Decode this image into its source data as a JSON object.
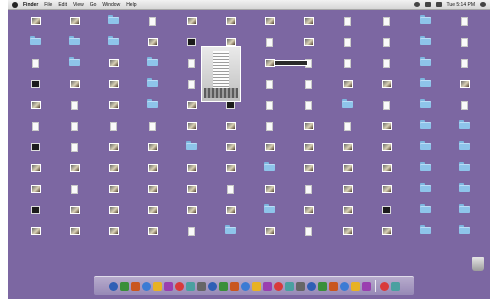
{
  "menubar": {
    "app_name": "Finder",
    "menus": [
      "File",
      "Edit",
      "View",
      "Go",
      "Window",
      "Help"
    ],
    "clock": "Tue 5:14 PM"
  },
  "desktop": {
    "background_color": "#7c67a2",
    "icons": [
      {
        "type": "image",
        "label": ""
      },
      {
        "type": "image",
        "label": ""
      },
      {
        "type": "folder",
        "label": ""
      },
      {
        "type": "doc",
        "label": ""
      },
      {
        "type": "image",
        "label": ""
      },
      {
        "type": "image",
        "label": ""
      },
      {
        "type": "image",
        "label": ""
      },
      {
        "type": "image",
        "label": ""
      },
      {
        "type": "doc",
        "label": ""
      },
      {
        "type": "doc",
        "label": ""
      },
      {
        "type": "folder",
        "label": ""
      },
      {
        "type": "doc",
        "label": ""
      },
      {
        "type": "folder",
        "label": ""
      },
      {
        "type": "folder",
        "label": ""
      },
      {
        "type": "folder",
        "label": ""
      },
      {
        "type": "image",
        "label": ""
      },
      {
        "type": "dark",
        "label": ""
      },
      {
        "type": "image",
        "label": ""
      },
      {
        "type": "doc",
        "label": ""
      },
      {
        "type": "image",
        "label": ""
      },
      {
        "type": "doc",
        "label": ""
      },
      {
        "type": "doc",
        "label": ""
      },
      {
        "type": "folder",
        "label": ""
      },
      {
        "type": "doc",
        "label": ""
      },
      {
        "type": "doc",
        "label": ""
      },
      {
        "type": "folder",
        "label": ""
      },
      {
        "type": "image",
        "label": ""
      },
      {
        "type": "folder",
        "label": ""
      },
      {
        "type": "doc",
        "label": ""
      },
      {
        "type": "image",
        "label": ""
      },
      {
        "type": "image",
        "label": ""
      },
      {
        "type": "doc",
        "label": ""
      },
      {
        "type": "doc",
        "label": ""
      },
      {
        "type": "doc",
        "label": ""
      },
      {
        "type": "folder",
        "label": ""
      },
      {
        "type": "doc",
        "label": ""
      },
      {
        "type": "dark",
        "label": ""
      },
      {
        "type": "image",
        "label": ""
      },
      {
        "type": "image",
        "label": ""
      },
      {
        "type": "folder",
        "label": ""
      },
      {
        "type": "doc",
        "label": ""
      },
      {
        "type": "image",
        "label": ""
      },
      {
        "type": "doc",
        "label": ""
      },
      {
        "type": "doc",
        "label": ""
      },
      {
        "type": "image",
        "label": ""
      },
      {
        "type": "image",
        "label": ""
      },
      {
        "type": "folder",
        "label": ""
      },
      {
        "type": "image",
        "label": ""
      },
      {
        "type": "image",
        "label": ""
      },
      {
        "type": "doc",
        "label": ""
      },
      {
        "type": "image",
        "label": ""
      },
      {
        "type": "folder",
        "label": ""
      },
      {
        "type": "image",
        "label": ""
      },
      {
        "type": "dark",
        "label": ""
      },
      {
        "type": "doc",
        "label": ""
      },
      {
        "type": "doc",
        "label": ""
      },
      {
        "type": "folder",
        "label": ""
      },
      {
        "type": "doc",
        "label": ""
      },
      {
        "type": "folder",
        "label": ""
      },
      {
        "type": "doc",
        "label": ""
      },
      {
        "type": "doc",
        "label": ""
      },
      {
        "type": "doc",
        "label": ""
      },
      {
        "type": "doc",
        "label": ""
      },
      {
        "type": "doc",
        "label": ""
      },
      {
        "type": "image",
        "label": ""
      },
      {
        "type": "image",
        "label": ""
      },
      {
        "type": "doc",
        "label": ""
      },
      {
        "type": "image",
        "label": ""
      },
      {
        "type": "doc",
        "label": ""
      },
      {
        "type": "image",
        "label": ""
      },
      {
        "type": "folder",
        "label": ""
      },
      {
        "type": "folder",
        "label": ""
      },
      {
        "type": "dark",
        "label": ""
      },
      {
        "type": "doc",
        "label": ""
      },
      {
        "type": "image",
        "label": ""
      },
      {
        "type": "image",
        "label": ""
      },
      {
        "type": "folder",
        "label": ""
      },
      {
        "type": "image",
        "label": ""
      },
      {
        "type": "image",
        "label": ""
      },
      {
        "type": "image",
        "label": ""
      },
      {
        "type": "image",
        "label": ""
      },
      {
        "type": "image",
        "label": ""
      },
      {
        "type": "folder",
        "label": ""
      },
      {
        "type": "folder",
        "label": ""
      },
      {
        "type": "image",
        "label": ""
      },
      {
        "type": "image",
        "label": ""
      },
      {
        "type": "image",
        "label": ""
      },
      {
        "type": "image",
        "label": ""
      },
      {
        "type": "image",
        "label": ""
      },
      {
        "type": "image",
        "label": ""
      },
      {
        "type": "folder",
        "label": ""
      },
      {
        "type": "image",
        "label": ""
      },
      {
        "type": "image",
        "label": ""
      },
      {
        "type": "image",
        "label": ""
      },
      {
        "type": "folder",
        "label": ""
      },
      {
        "type": "folder",
        "label": ""
      },
      {
        "type": "image",
        "label": ""
      },
      {
        "type": "doc",
        "label": ""
      },
      {
        "type": "image",
        "label": ""
      },
      {
        "type": "image",
        "label": ""
      },
      {
        "type": "image",
        "label": ""
      },
      {
        "type": "doc",
        "label": ""
      },
      {
        "type": "image",
        "label": ""
      },
      {
        "type": "doc",
        "label": ""
      },
      {
        "type": "image",
        "label": ""
      },
      {
        "type": "image",
        "label": ""
      },
      {
        "type": "folder",
        "label": ""
      },
      {
        "type": "folder",
        "label": ""
      },
      {
        "type": "dark",
        "label": ""
      },
      {
        "type": "image",
        "label": ""
      },
      {
        "type": "image",
        "label": ""
      },
      {
        "type": "image",
        "label": ""
      },
      {
        "type": "image",
        "label": ""
      },
      {
        "type": "image",
        "label": ""
      },
      {
        "type": "folder",
        "label": ""
      },
      {
        "type": "image",
        "label": ""
      },
      {
        "type": "image",
        "label": ""
      },
      {
        "type": "dark",
        "label": ""
      },
      {
        "type": "folder",
        "label": ""
      },
      {
        "type": "folder",
        "label": ""
      },
      {
        "type": "image",
        "label": ""
      },
      {
        "type": "image",
        "label": ""
      },
      {
        "type": "image",
        "label": ""
      },
      {
        "type": "image",
        "label": ""
      },
      {
        "type": "doc",
        "label": ""
      },
      {
        "type": "folder",
        "label": ""
      },
      {
        "type": "image",
        "label": ""
      },
      {
        "type": "doc",
        "label": ""
      },
      {
        "type": "image",
        "label": ""
      },
      {
        "type": "image",
        "label": ""
      },
      {
        "type": "folder",
        "label": ""
      },
      {
        "type": "folder",
        "label": ""
      }
    ]
  },
  "dock": {
    "items": [
      "finder-icon",
      "dashboard-icon",
      "mail-icon",
      "safari-icon",
      "photos-icon",
      "itunes-icon",
      "ical-icon",
      "preview-icon",
      "app-icon",
      "app-icon",
      "app-icon",
      "app-icon",
      "app-icon",
      "app-icon",
      "app-icon",
      "app-icon",
      "app-icon",
      "app-icon",
      "app-icon",
      "app-icon",
      "app-icon",
      "app-icon",
      "app-icon",
      "app-icon",
      "folder-icon",
      "folder-icon"
    ]
  }
}
